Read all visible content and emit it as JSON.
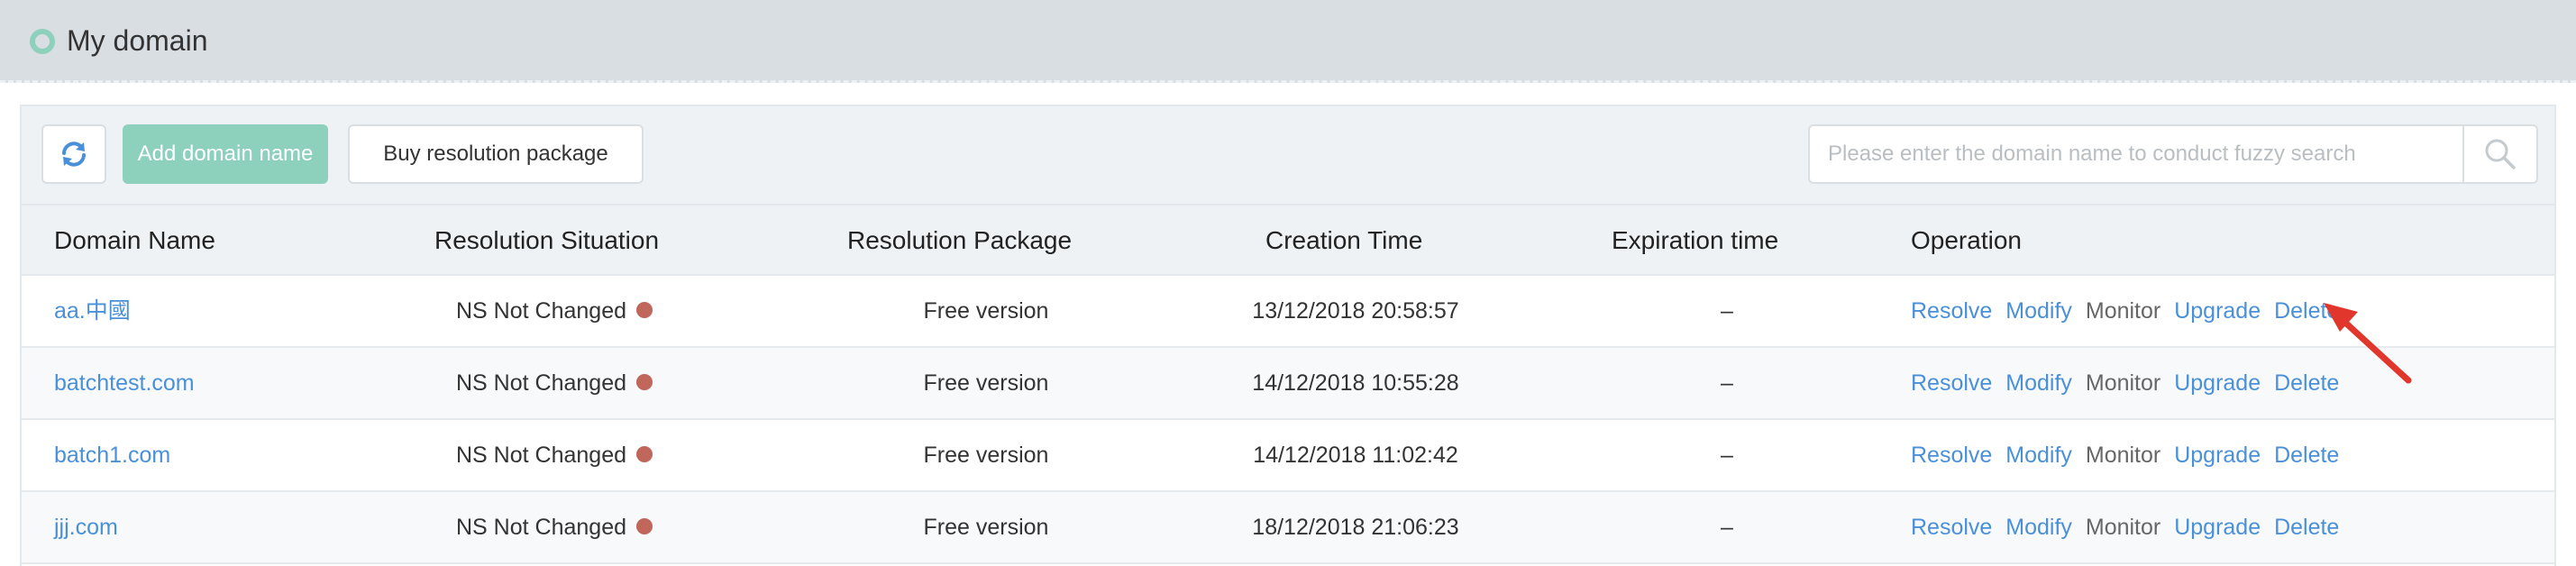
{
  "header": {
    "title": "My domain"
  },
  "toolbar": {
    "refresh_icon": "refresh-icon",
    "add_label": "Add domain name",
    "buy_label": "Buy resolution package",
    "search_placeholder": "Please enter the domain name to conduct fuzzy search",
    "search_icon": "search-icon"
  },
  "table": {
    "columns": [
      "Domain Name",
      "Resolution Situation",
      "Resolution Package",
      "Creation Time",
      "Expiration time",
      "Operation"
    ],
    "rows": [
      {
        "domain": "aa.中國",
        "status": "NS Not Changed",
        "package": "Free version",
        "created": "13/12/2018 20:58:57",
        "expires": "–"
      },
      {
        "domain": "batchtest.com",
        "status": "NS Not Changed",
        "package": "Free version",
        "created": "14/12/2018 10:55:28",
        "expires": "–"
      },
      {
        "domain": "batch1.com",
        "status": "NS Not Changed",
        "package": "Free version",
        "created": "14/12/2018 11:02:42",
        "expires": "–"
      },
      {
        "domain": "jjj.com",
        "status": "NS Not Changed",
        "package": "Free version",
        "created": "18/12/2018 21:06:23",
        "expires": "–"
      }
    ],
    "operations": {
      "resolve": "Resolve",
      "modify": "Modify",
      "monitor": "Monitor",
      "upgrade": "Upgrade",
      "delete": "Delete"
    }
  },
  "colors": {
    "accent": "#8dd0bb",
    "link": "#4a90d9",
    "status_dot": "#c0665a",
    "annotation_arrow": "#e0362c"
  }
}
